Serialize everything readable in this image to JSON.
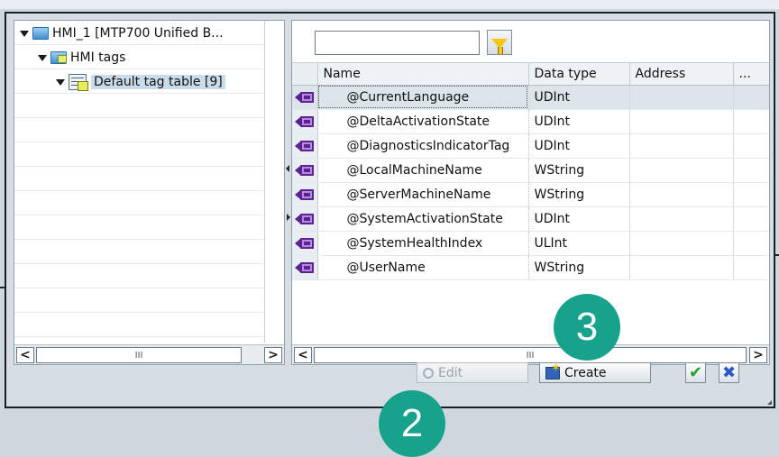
{
  "tree": {
    "root_label": "HMI_1 [MTP700 Unified B...",
    "tags_folder_label": "HMI tags",
    "tag_table_label": "Default tag table [9]"
  },
  "filter": {
    "value": "",
    "placeholder": ""
  },
  "table": {
    "columns": [
      "Name",
      "Data type",
      "Address",
      "..."
    ],
    "rows": [
      {
        "name": "@CurrentLanguage",
        "type": "UDInt",
        "address": ""
      },
      {
        "name": "@DeltaActivationState",
        "type": "UDInt",
        "address": ""
      },
      {
        "name": "@DiagnosticsIndicatorTag",
        "type": "UDInt",
        "address": ""
      },
      {
        "name": "@LocalMachineName",
        "type": "WString",
        "address": ""
      },
      {
        "name": "@ServerMachineName",
        "type": "WString",
        "address": ""
      },
      {
        "name": "@SystemActivationState",
        "type": "UDInt",
        "address": ""
      },
      {
        "name": "@SystemHealthIndex",
        "type": "ULInt",
        "address": ""
      },
      {
        "name": "@UserName",
        "type": "WString",
        "address": ""
      }
    ],
    "selected_row": 0
  },
  "scrollbars": {
    "left_left_arrow": "<",
    "left_right_arrow": ">",
    "thumb_grip": "III",
    "right_left_arrow": "<",
    "right_right_arrow": ">"
  },
  "buttons": {
    "edit_label": "Edit",
    "create_label": "Create",
    "ok_glyph": "✔",
    "cancel_glyph": "✖"
  },
  "callouts": {
    "step_3": "3",
    "step_2": "2"
  },
  "colors": {
    "callout": "#17a28c",
    "selection": "#dde4ea",
    "tag_icon": "#5a2390"
  }
}
